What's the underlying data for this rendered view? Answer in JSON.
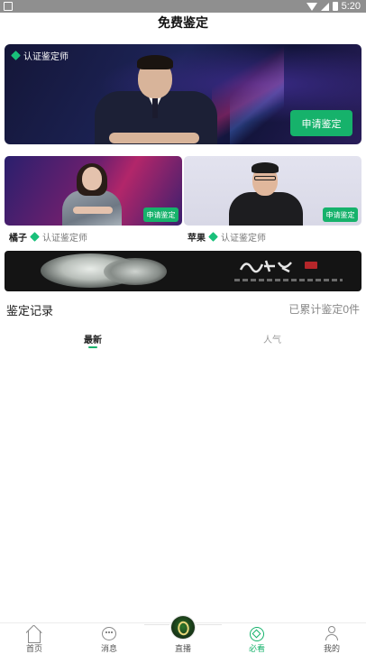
{
  "status_bar": {
    "time": "5:20"
  },
  "header": {
    "title": "免费鉴定"
  },
  "hero": {
    "badge_text": "认证鉴定师",
    "apply_label": "申请鉴定"
  },
  "cards": [
    {
      "name": "橘子",
      "cert": "认证鉴定师",
      "apply_label": "申请鉴定"
    },
    {
      "name": "苹果",
      "cert": "认证鉴定师",
      "apply_label": "申请鉴定"
    }
  ],
  "records": {
    "title": "鉴定记录",
    "count_text": "已累计鉴定0件",
    "tabs": [
      {
        "label": "最新",
        "active": true
      },
      {
        "label": "人气",
        "active": false
      }
    ]
  },
  "bottom_nav": {
    "items": [
      {
        "label": "首页",
        "icon": "home-icon"
      },
      {
        "label": "消息",
        "icon": "message-icon"
      },
      {
        "label": "直播",
        "icon": "live-icon"
      },
      {
        "label": "必看",
        "icon": "must-watch-icon",
        "active": true
      },
      {
        "label": "我的",
        "icon": "profile-icon"
      }
    ]
  },
  "colors": {
    "accent": "#16b26b",
    "badge": "#19c07a"
  }
}
